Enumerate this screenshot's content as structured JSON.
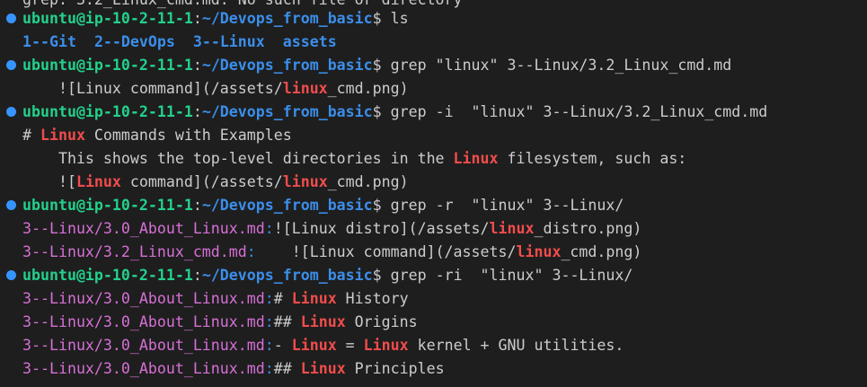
{
  "theme": {
    "background": "#1e1e1e",
    "foreground": "#cccccc",
    "prompt_user": "#23d18b",
    "prompt_path": "#3b8eea",
    "match": "#f14c4c",
    "filename": "#d670d6",
    "prompt_dot": "#3794ff"
  },
  "prompt": {
    "user_host": "ubuntu@ip-10-2-11-1",
    "colon": ":",
    "path": "~/Devops_from_basic",
    "dollar": "$ "
  },
  "top_partial": "grep: 3.2_Linux_cmd.md: No such file or directory",
  "commands": {
    "ls": "ls",
    "grep1": "grep \"linux\" 3--Linux/3.2_Linux_cmd.md",
    "grep2": "grep -i  \"linux\" 3--Linux/3.2_Linux_cmd.md",
    "grep3": "grep -r  \"linux\" 3--Linux/",
    "grep4": "grep -ri  \"linux\" 3--Linux/"
  },
  "ls_output": [
    "1--Git",
    "2--DevOps",
    "3--Linux",
    "assets"
  ],
  "grep1_output": {
    "pre": "    ![Linux command](/assets/",
    "match": "linux",
    "post": "_cmd.png)"
  },
  "grep2_output": [
    {
      "pre": "# ",
      "match": "Linux",
      "post": " Commands with Examples"
    },
    {
      "pre": "    This shows the top-level directories in the ",
      "match": "Linux",
      "post": " filesystem, such as:"
    },
    {
      "pre": "    ![",
      "match": "Linux",
      "post": " command](/assets/",
      "match2": "linux",
      "post2": "_cmd.png)"
    }
  ],
  "grep3_output": [
    {
      "file": "3--Linux/3.0_About_Linux.md",
      "sep": ":",
      "pre": "![Linux distro](/assets/",
      "match": "linux",
      "post": "_distro.png)"
    },
    {
      "file": "3--Linux/3.2_Linux_cmd.md",
      "sep": ":",
      "pre": "    ![Linux command](/assets/",
      "match": "linux",
      "post": "_cmd.png)"
    }
  ],
  "grep4_output": [
    {
      "file": "3--Linux/3.0_About_Linux.md",
      "sep": ":",
      "pre": "# ",
      "match": "Linux",
      "post": " History"
    },
    {
      "file": "3--Linux/3.0_About_Linux.md",
      "sep": ":",
      "pre": "## ",
      "match": "Linux",
      "post": " Origins"
    },
    {
      "file": "3--Linux/3.0_About_Linux.md",
      "sep": ":",
      "pre": "- ",
      "match": "Linux",
      "post": " = ",
      "match2": "Linux",
      "post2": " kernel + GNU utilities."
    },
    {
      "file": "3--Linux/3.0_About_Linux.md",
      "sep": ":",
      "pre": "## ",
      "match": "Linux",
      "post": " Principles"
    }
  ]
}
